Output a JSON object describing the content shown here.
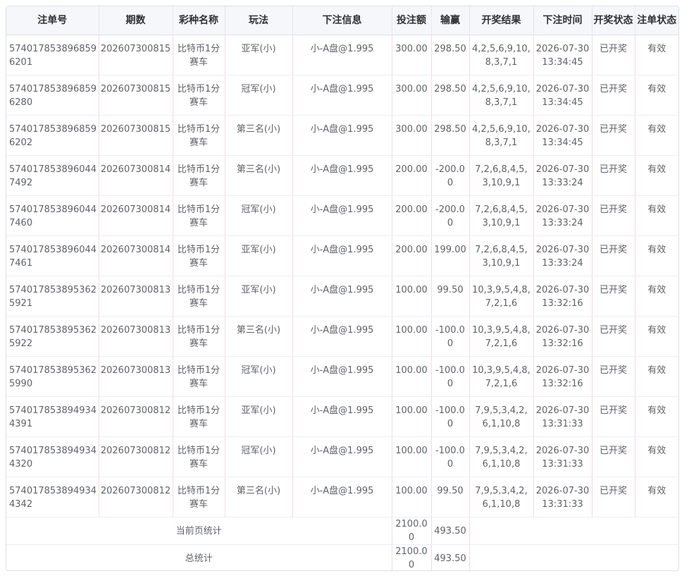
{
  "headers": [
    "注单号",
    "期数",
    "彩种名称",
    "玩法",
    "下注信息",
    "投注额",
    "输赢",
    "开奖结果",
    "下注时间",
    "开奖状态",
    "注单状态"
  ],
  "rows": [
    {
      "order_id": "5740178538968596201",
      "period": "202607300815",
      "lottery": "比特币1分赛车",
      "play": "亚军(小)",
      "bet_info": "小-A盘@1.995",
      "amount": "300.00",
      "win_loss": "298.50",
      "result": "4,2,5,6,9,10,8,3,7,1",
      "bet_time": "2026-07-30 13:34:45",
      "draw_status": "已开奖",
      "order_status": "有效"
    },
    {
      "order_id": "5740178538968596280",
      "period": "202607300815",
      "lottery": "比特币1分赛车",
      "play": "冠军(小)",
      "bet_info": "小-A盘@1.995",
      "amount": "300.00",
      "win_loss": "298.50",
      "result": "4,2,5,6,9,10,8,3,7,1",
      "bet_time": "2026-07-30 13:34:45",
      "draw_status": "已开奖",
      "order_status": "有效"
    },
    {
      "order_id": "5740178538968596202",
      "period": "202607300815",
      "lottery": "比特币1分赛车",
      "play": "第三名(小)",
      "bet_info": "小-A盘@1.995",
      "amount": "300.00",
      "win_loss": "298.50",
      "result": "4,2,5,6,9,10,8,3,7,1",
      "bet_time": "2026-07-30 13:34:45",
      "draw_status": "已开奖",
      "order_status": "有效"
    },
    {
      "order_id": "5740178538960447492",
      "period": "202607300814",
      "lottery": "比特币1分赛车",
      "play": "第三名(小)",
      "bet_info": "小-A盘@1.995",
      "amount": "200.00",
      "win_loss": "-200.00",
      "result": "7,2,6,8,4,5,3,10,9,1",
      "bet_time": "2026-07-30 13:33:24",
      "draw_status": "已开奖",
      "order_status": "有效"
    },
    {
      "order_id": "5740178538960447460",
      "period": "202607300814",
      "lottery": "比特币1分赛车",
      "play": "冠军(小)",
      "bet_info": "小-A盘@1.995",
      "amount": "200.00",
      "win_loss": "-200.00",
      "result": "7,2,6,8,4,5,3,10,9,1",
      "bet_time": "2026-07-30 13:33:24",
      "draw_status": "已开奖",
      "order_status": "有效"
    },
    {
      "order_id": "5740178538960447461",
      "period": "202607300814",
      "lottery": "比特币1分赛车",
      "play": "亚军(小)",
      "bet_info": "小-A盘@1.995",
      "amount": "200.00",
      "win_loss": "199.00",
      "result": "7,2,6,8,4,5,3,10,9,1",
      "bet_time": "2026-07-30 13:33:24",
      "draw_status": "已开奖",
      "order_status": "有效"
    },
    {
      "order_id": "5740178538953625921",
      "period": "202607300813",
      "lottery": "比特币1分赛车",
      "play": "亚军(小)",
      "bet_info": "小-A盘@1.995",
      "amount": "100.00",
      "win_loss": "99.50",
      "result": "10,3,9,5,4,8,7,2,1,6",
      "bet_time": "2026-07-30 13:32:16",
      "draw_status": "已开奖",
      "order_status": "有效"
    },
    {
      "order_id": "5740178538953625922",
      "period": "202607300813",
      "lottery": "比特币1分赛车",
      "play": "第三名(小)",
      "bet_info": "小-A盘@1.995",
      "amount": "100.00",
      "win_loss": "-100.00",
      "result": "10,3,9,5,4,8,7,2,1,6",
      "bet_time": "2026-07-30 13:32:16",
      "draw_status": "已开奖",
      "order_status": "有效"
    },
    {
      "order_id": "5740178538953625990",
      "period": "202607300813",
      "lottery": "比特币1分赛车",
      "play": "冠军(小)",
      "bet_info": "小-A盘@1.995",
      "amount": "100.00",
      "win_loss": "-100.00",
      "result": "10,3,9,5,4,8,7,2,1,6",
      "bet_time": "2026-07-30 13:32:16",
      "draw_status": "已开奖",
      "order_status": "有效"
    },
    {
      "order_id": "5740178538949344391",
      "period": "202607300812",
      "lottery": "比特币1分赛车",
      "play": "亚军(小)",
      "bet_info": "小-A盘@1.995",
      "amount": "100.00",
      "win_loss": "-100.00",
      "result": "7,9,5,3,4,2,6,1,10,8",
      "bet_time": "2026-07-30 13:31:33",
      "draw_status": "已开奖",
      "order_status": "有效"
    },
    {
      "order_id": "5740178538949344320",
      "period": "202607300812",
      "lottery": "比特币1分赛车",
      "play": "冠军(小)",
      "bet_info": "小-A盘@1.995",
      "amount": "100.00",
      "win_loss": "-100.00",
      "result": "7,9,5,3,4,2,6,1,10,8",
      "bet_time": "2026-07-30 13:31:33",
      "draw_status": "已开奖",
      "order_status": "有效"
    },
    {
      "order_id": "5740178538949344342",
      "period": "202607300812",
      "lottery": "比特币1分赛车",
      "play": "第三名(小)",
      "bet_info": "小-A盘@1.995",
      "amount": "100.00",
      "win_loss": "99.50",
      "result": "7,9,5,3,4,2,6,1,10,8",
      "bet_time": "2026-07-30 13:31:33",
      "draw_status": "已开奖",
      "order_status": "有效"
    }
  ],
  "summary": [
    {
      "label": "当前页统计",
      "amount": "2100.00",
      "win_loss": "493.50"
    },
    {
      "label": "总统计",
      "amount": "2100.00",
      "win_loss": "493.50"
    }
  ]
}
